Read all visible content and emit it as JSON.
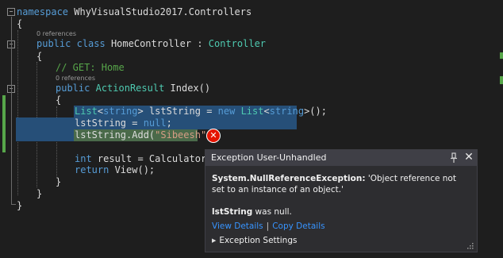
{
  "code": {
    "l1_kw": "namespace",
    "l1_rest": " WhyVisualStudio2017.Controllers",
    "l2": "{",
    "lens1": "0 references",
    "l3_kw1": "public",
    "l3_kw2": "class",
    "l3_name": " HomeController : ",
    "l3_type": "Controller",
    "l4": "{",
    "l5_cmt": "// GET: Home",
    "lens2": "0 references",
    "l6_kw": "public",
    "l6_type": "ActionResult",
    "l6_rest": " Index()",
    "l7": "{",
    "l8_t1": "List",
    "l8_a": "<",
    "l8_kw1": "string",
    "l8_b": "> lstString = ",
    "l8_kw2": "new",
    "l8_t2": "List",
    "l8_c": "<",
    "l8_kw3": "string",
    "l8_d": ">();",
    "l9_a": "lstString = ",
    "l9_kw": "null",
    "l9_b": ";",
    "l10_a": "lstString.Add(",
    "l10_str": "\"Sibeesh\"",
    "l10_b": ");",
    "l11_kw": "int",
    "l11_rest": " result = Calculator.Ca",
    "l12_kw": "return",
    "l12_rest": " View();",
    "l13": "}",
    "l14": "}",
    "l15": "}"
  },
  "popup": {
    "title": "Exception User-Unhandled",
    "pin_icon": "pin-icon",
    "close_icon": "close-icon",
    "exception_type": "System.NullReferenceException:",
    "exception_message": " 'Object reference not set to an instance of an object.'",
    "null_var": "lstString",
    "null_suffix": " was null.",
    "view_details": "View Details",
    "separator": "|",
    "copy_details": "Copy Details",
    "settings_label": "Exception Settings"
  },
  "colors": {
    "background": "#1e1e1e",
    "keyword": "#569cd6",
    "type": "#4ec9b0",
    "string": "#d69d85",
    "comment": "#57a64a",
    "selection": "#264f78",
    "link": "#3794ff",
    "error": "#e51400"
  }
}
